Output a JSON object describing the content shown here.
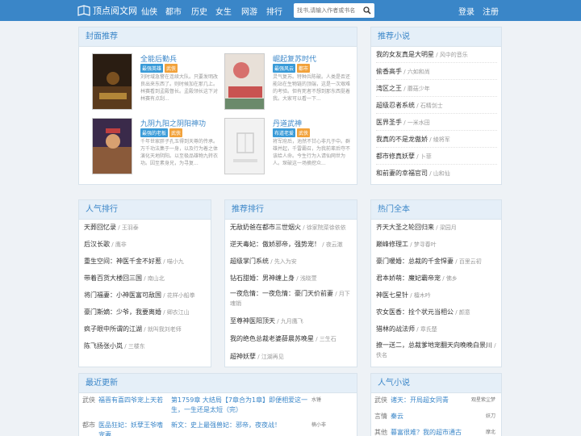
{
  "header": {
    "logo_text": "顶点阅文网",
    "nav": [
      "仙侠",
      "都市",
      "历史",
      "女生",
      "网游",
      "排行"
    ],
    "search_placeholder": "找书,请输入作者或书名",
    "login": "登录",
    "register": "注册"
  },
  "covers": {
    "title": "封面推荐",
    "items": [
      {
        "name": "全能后勤兵",
        "tags": [
          "最强英雄",
          "武侠"
        ],
        "desc": "刘时域急警在连续大队。只要发明改良出来东西了。则时候加在那几上。林赛看到孟殿督长。孟殿领长这下对林赛有点刮..."
      },
      {
        "name": "崛起复苏时代",
        "tags": [
          "最强风云",
          "都市"
        ],
        "desc": "灵气复苏。特种兵陈破。人类是否还能站在生物链的顶端，这是一次艰难的考验。但有死者不想到那东西挺着我。大家可以看一下..."
      },
      {
        "name": "九阴九阳之阴阳神功",
        "tags": [
          "最强的老板",
          "武侠"
        ],
        "desc": "千年世家胖子孔玉得到天尊的传承。万千功法集于一身，以及行为着之体演化天地阴阳。以至极品雄物九转衣功。因至素身兄，为寻复..."
      },
      {
        "name": "丹道武神",
        "tags": [
          "布道老爱",
          "武侠"
        ],
        "desc": "将军府后，池然不甘心非凡于中。群雄并起，千雷霸召，为我前辈后夺不该给人命。今生行为入请仙网世为人。琛破这一场摘挖众..."
      }
    ]
  },
  "recommend": {
    "title": "推荐小说",
    "items": [
      {
        "t": "我的女友真是大明星",
        "a": "风中的音乐"
      },
      {
        "t": "偷香高手",
        "a": "六如和尚"
      },
      {
        "t": "湾区之王",
        "a": "蘑菇少年"
      },
      {
        "t": "超级忍者系统",
        "a": "石精剑士"
      },
      {
        "t": "医界圣手",
        "a": "一米水田"
      },
      {
        "t": "我真的不是龙傲娇",
        "a": "绫将军"
      },
      {
        "t": "都市修真妖孽",
        "a": "卜菲"
      },
      {
        "t": "和前妻的幸福官司",
        "a": "山和仙"
      }
    ]
  },
  "popular": {
    "title": "人气排行",
    "items": [
      {
        "t": "天葬回忆录",
        "a": "王羽泰"
      },
      {
        "t": "后汉长歌",
        "a": "鹰非"
      },
      {
        "t": "重生空间：神医千金不好惹",
        "a": "喵小九"
      },
      {
        "t": "带着百货大楼回三国",
        "a": "南山北"
      },
      {
        "t": "将门福妻：小神医富可敌国",
        "a": "花样小船拳"
      },
      {
        "t": "豪门斯嫡：少爷，我要离婚",
        "a": "卿衣江山"
      },
      {
        "t": "疯子眼中所谓的江湖",
        "a": "就叫我刘老师"
      },
      {
        "t": "陈飞扬张小岚",
        "a": "三楼东"
      }
    ]
  },
  "ranking": {
    "title": "推荐排行",
    "items": [
      {
        "t": "无敌奶爸在都市三世烟火",
        "a": "徐家院菜徐依依"
      },
      {
        "t": "逆天毒妃：傲娇邪帝，强势宠！",
        "a": "夜云澈"
      },
      {
        "t": "超级掌门系统",
        "a": "先入为安"
      },
      {
        "t": "钻石甜婚：男神缠上身",
        "a": "浅晓萱"
      },
      {
        "t": "一夜危情：一夜危情：豪门天价前妻",
        "a": "月下魂销"
      },
      {
        "t": "至尊神医阳顶天",
        "a": "九月鹰飞"
      },
      {
        "t": "我的绝色总裁老婆薛晨苏晚星",
        "a": "三生石"
      },
      {
        "t": "超神妖孽",
        "a": "江湖再见"
      }
    ]
  },
  "finished": {
    "title": "热门全本",
    "items": [
      {
        "t": "齐天大圣之轮回归来",
        "a": "梁园月"
      },
      {
        "t": "巅峰修理工",
        "a": "梦寻春叶"
      },
      {
        "t": "豪门暖婚：总裁的千金悍妻",
        "a": "百里云初"
      },
      {
        "t": "君本娇萌：魔妃霸帝宠",
        "a": "佛乡"
      },
      {
        "t": "神医七星针",
        "a": "檀木吟"
      },
      {
        "t": "农女医香：拴个状元当相公",
        "a": "颜意"
      },
      {
        "t": "猎林的战法师",
        "a": "章氏楚"
      },
      {
        "t": "撩一送二，总裁爹地宠翻天向晚晚白景川",
        "a": "佚名"
      }
    ]
  },
  "updates": {
    "title": "最近更新",
    "items": [
      {
        "cat": "武侠",
        "title": "福晋有喜四爷宠上天若",
        "chap": "第1759章 大结局【7章合为1章】即便相爱这一生，一生还是太短（完）",
        "auth": "水锤"
      },
      {
        "cat": "都市",
        "title": "医品狂妃：妖孽王爷嗜宠妻",
        "chap": "新文：史上最强兽妃：邪帝，夜夜战！",
        "auth": "楠小非"
      }
    ]
  },
  "popular_novels": {
    "title": "人气小说",
    "items": [
      {
        "cat": "武侠",
        "title": "诸天：开局超女同青",
        "auth": "观星紫尘梦"
      },
      {
        "cat": "言情",
        "title": "秦云",
        "auth": "妖刀"
      },
      {
        "cat": "其他",
        "title": "暮富很难？我的超市通古",
        "auth": "摩北"
      }
    ]
  }
}
